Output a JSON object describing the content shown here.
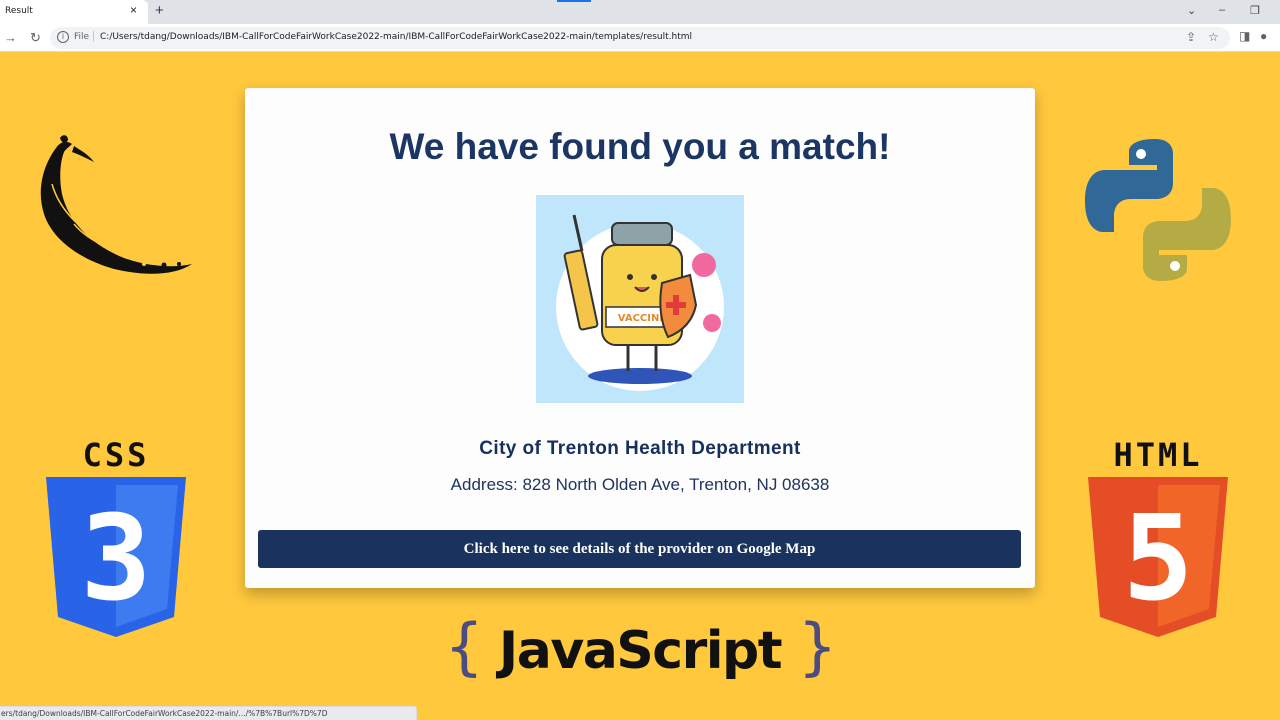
{
  "browser": {
    "tab_title": "Result",
    "tab_close": "×",
    "new_tab": "+",
    "file_label": "File",
    "url": "C:/Users/tdang/Downloads/IBM-CallForCodeFairWorkCase2022-main/IBM-CallForCodeFairWorkCase2022-main/templates/result.html",
    "status_url": "ers/tdang/Downloads/IBM-CallForCodeFairWorkCase2022-main/.../%7B%7Burl%7D%7D"
  },
  "card": {
    "headline": "We have found you a match!",
    "vaccine_label": "VACCINE",
    "provider_name": "City of Trenton Health Department",
    "provider_address": "Address: 828 North Olden Ave, Trenton, NJ 08638",
    "map_button_label": "Click here to see details of the provider on Google Map"
  },
  "logos": {
    "css_word": "CSS",
    "css_number": "3",
    "html_word": "HTML",
    "html_number": "5",
    "js_open_brace": "{",
    "js_word": "JavaScript",
    "js_close_brace": "}"
  },
  "colors": {
    "background": "#ffc83d",
    "headline": "#1b3663",
    "button": "#19325e",
    "css_blue": "#2863e8",
    "html_orange": "#e44d26",
    "python_blue": "#306998",
    "python_yellow": "#b5ab45"
  }
}
